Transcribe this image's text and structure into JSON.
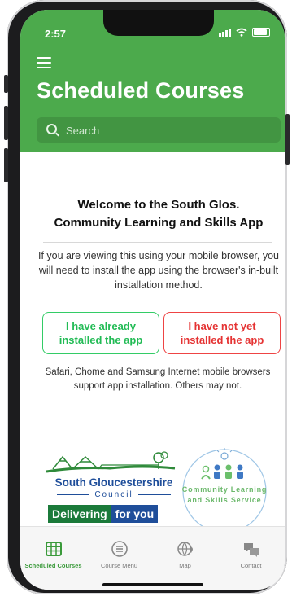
{
  "status": {
    "time": "2:57"
  },
  "header": {
    "title": "Scheduled Courses"
  },
  "search": {
    "placeholder": "Search"
  },
  "welcome": {
    "line1": "Welcome to the South Glos.",
    "line2": "Community Learning and Skills App"
  },
  "notice": {
    "text": "If you are viewing this using your mobile browser, you will need to install the app using the browser's in-built installation method."
  },
  "buttons": {
    "installed_line1": "I have already",
    "installed_line2": "installed the app",
    "not_installed_line1": "I have not yet",
    "not_installed_line2": "installed the app"
  },
  "browser_note": {
    "text": "Safari, Chome and Samsung Internet mobile browsers support app installation. Others may not."
  },
  "logos": {
    "sg_line1": "South Gloucestershire",
    "sg_line2": "Council",
    "sg_tag_a": "Delivering",
    "sg_tag_b": "for you",
    "cls_line1": "Community Learning",
    "cls_line2": "and Skills Service"
  },
  "tabs": [
    {
      "label": "Scheduled Courses",
      "icon": "calendar-grid-icon",
      "active": true
    },
    {
      "label": "Course Menu",
      "icon": "list-circle-icon",
      "active": false
    },
    {
      "label": "Map",
      "icon": "globe-pin-icon",
      "active": false
    },
    {
      "label": "Contact",
      "icon": "chat-bubbles-icon",
      "active": false
    }
  ],
  "colors": {
    "header_green": "#4caa4c",
    "button_green": "#22bb55",
    "button_red": "#e53333",
    "sg_blue": "#1f4e9a",
    "sg_dark_green": "#1b7a3a"
  }
}
